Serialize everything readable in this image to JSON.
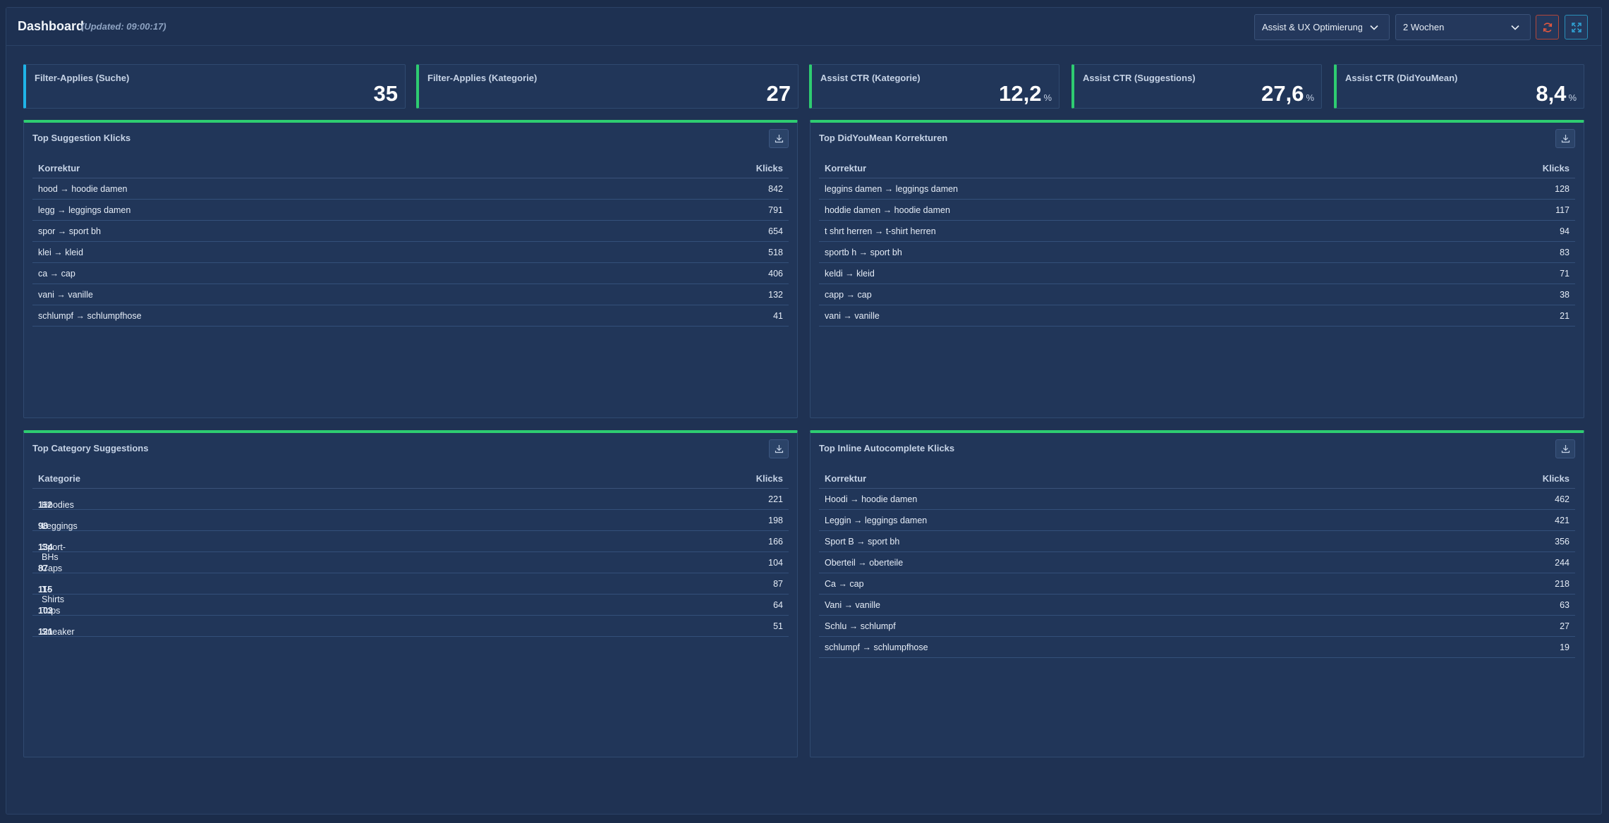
{
  "header": {
    "title": "Dashboard",
    "updated": "(Updated: 09:00:17)",
    "view_select": "Assist & UX Optimierung",
    "range_select": "2 Wochen"
  },
  "kpis": [
    {
      "label": "Filter-Applies (Suche)",
      "value": "35",
      "unit": ""
    },
    {
      "label": "Filter-Applies (Kategorie)",
      "value": "27",
      "unit": ""
    },
    {
      "label": "Assist CTR (Kategorie)",
      "value": "12,2",
      "unit": "%"
    },
    {
      "label": "Assist CTR (Suggestions)",
      "value": "27,6",
      "unit": "%"
    },
    {
      "label": "Assist CTR (DidYouMean)",
      "value": "8,4",
      "unit": "%"
    }
  ],
  "panels": {
    "suggestions": {
      "title": "Top Suggestion Klicks",
      "col1": "Korrektur",
      "col2": "Klicks",
      "rows": [
        {
          "label": "hood → hoodie damen",
          "value": "842"
        },
        {
          "label": "legg → leggings damen",
          "value": "791"
        },
        {
          "label": "spor → sport bh",
          "value": "654"
        },
        {
          "label": "klei → kleid",
          "value": "518"
        },
        {
          "label": "ca → cap",
          "value": "406"
        },
        {
          "label": "vani → vanille",
          "value": "132"
        },
        {
          "label": "schlumpf → schlumpfhose",
          "value": "41"
        }
      ]
    },
    "didyoumean": {
      "title": "Top DidYouMean Korrekturen",
      "col1": "Korrektur",
      "col2": "Klicks",
      "rows": [
        {
          "label": "leggins damen → leggings damen",
          "value": "128"
        },
        {
          "label": "hoddie damen → hoodie damen",
          "value": "117"
        },
        {
          "label": "t shrt herren → t-shirt herren",
          "value": "94"
        },
        {
          "label": "sportb h → sport bh",
          "value": "83"
        },
        {
          "label": "keldi → kleid",
          "value": "71"
        },
        {
          "label": "capp → cap",
          "value": "38"
        },
        {
          "label": "vani → vanille",
          "value": "21"
        }
      ]
    },
    "categories": {
      "title": "Top Category Suggestions",
      "col1": "Kategorie",
      "col2": "Klicks",
      "rows": [
        {
          "id": "112",
          "name": "Hoodies",
          "value": "221"
        },
        {
          "id": "98",
          "name": "Leggings",
          "value": "198"
        },
        {
          "id": "134",
          "name": "Sport-BHs",
          "value": "166"
        },
        {
          "id": "87",
          "name": "Caps",
          "value": "104"
        },
        {
          "id": "115",
          "name": "T-Shirts",
          "value": "87"
        },
        {
          "id": "103",
          "name": "Tops",
          "value": "64"
        },
        {
          "id": "121",
          "name": "Sneaker",
          "value": "51"
        }
      ]
    },
    "inline": {
      "title": "Top Inline Autocomplete Klicks",
      "col1": "Korrektur",
      "col2": "Klicks",
      "rows": [
        {
          "label": "Hoodi → hoodie damen",
          "value": "462"
        },
        {
          "label": "Leggin → leggings damen",
          "value": "421"
        },
        {
          "label": "Sport B → sport bh",
          "value": "356"
        },
        {
          "label": "Oberteil → oberteile",
          "value": "244"
        },
        {
          "label": "Ca → cap",
          "value": "218"
        },
        {
          "label": "Vani → vanille",
          "value": "63"
        },
        {
          "label": "Schlu → schlumpf",
          "value": "27"
        },
        {
          "label": "schlumpf → schlumpfhose",
          "value": "19"
        }
      ]
    }
  },
  "colors": {
    "accent_green": "#2ecc71",
    "accent_blue": "#1fb4e8",
    "refresh": "#e0573f",
    "fullscreen": "#2fa4d6"
  }
}
